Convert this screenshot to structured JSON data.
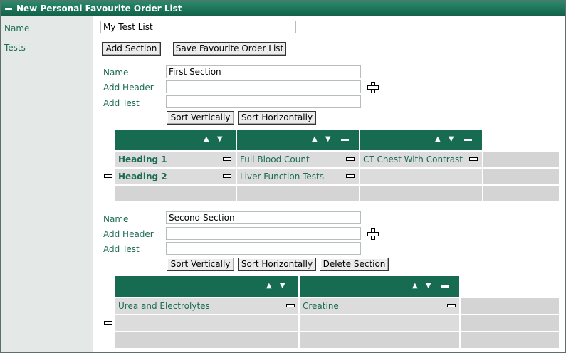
{
  "window": {
    "title": "New Personal Favourite Order List"
  },
  "form": {
    "name_label": "Name",
    "name_value": "My Test List",
    "tests_label": "Tests",
    "add_section_label": "Add Section",
    "save_label": "Save Favourite Order List"
  },
  "sections": [
    {
      "name_label": "Name",
      "name_value": "First Section",
      "add_header_label": "Add Header",
      "add_header_value": "",
      "add_test_label": "Add Test",
      "add_test_value": "",
      "sort_vertically_label": "Sort Vertically",
      "sort_horizontally_label": "Sort Horizontally",
      "grid": [
        [
          "Heading 1",
          "Full Blood Count",
          "CT Chest With Contrast"
        ],
        [
          "Heading 2",
          "Liver Function Tests",
          ""
        ],
        [
          "",
          "",
          ""
        ]
      ]
    },
    {
      "name_label": "Name",
      "name_value": "Second Section",
      "add_header_label": "Add Header",
      "add_header_value": "",
      "add_test_label": "Add Test",
      "add_test_value": "",
      "sort_vertically_label": "Sort Vertically",
      "sort_horizontally_label": "Sort Horizontally",
      "delete_section_label": "Delete Section",
      "grid": [
        [
          "Urea and Electrolytes",
          "Creatine"
        ],
        [
          "",
          ""
        ],
        [
          "",
          ""
        ]
      ]
    }
  ],
  "icons": {
    "sort_arrows": "▲ ▼",
    "accent": "#166b51",
    "label_color": "#1b6b55"
  }
}
